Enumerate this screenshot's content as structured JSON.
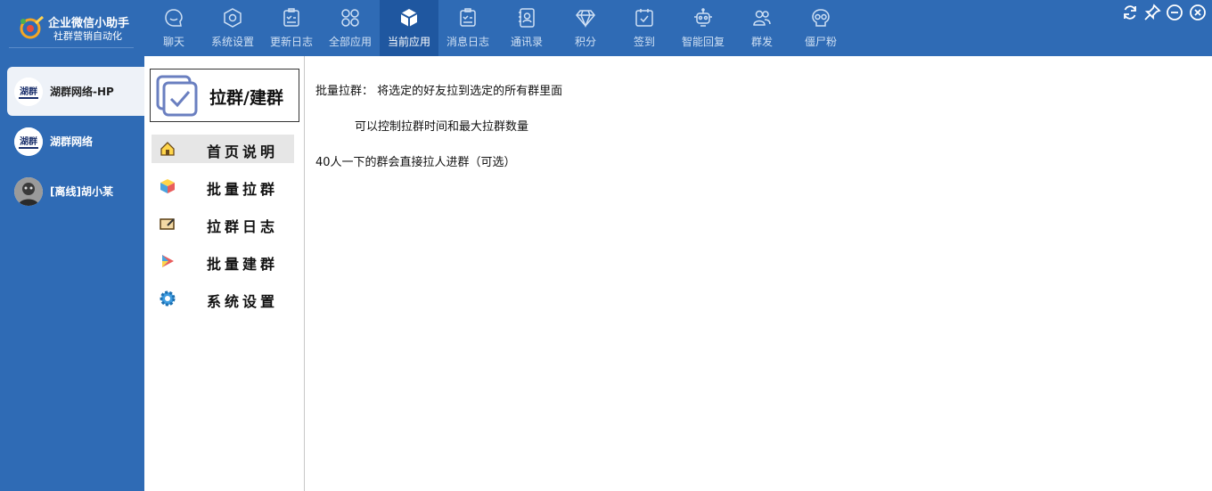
{
  "app": {
    "title": "企业微信小助手",
    "subtitle": "社群营销自动化"
  },
  "nav": [
    {
      "label": "聊天",
      "icon": "chat-icon",
      "active": false
    },
    {
      "label": "系统设置",
      "icon": "hexagon-settings-icon",
      "active": false
    },
    {
      "label": "更新日志",
      "icon": "checklist-icon",
      "active": false
    },
    {
      "label": "全部应用",
      "icon": "apps-grid-icon",
      "active": false
    },
    {
      "label": "当前应用",
      "icon": "cube-icon",
      "active": true
    },
    {
      "label": "消息日志",
      "icon": "checklist-icon",
      "active": false
    },
    {
      "label": "通讯录",
      "icon": "address-book-icon",
      "active": false
    },
    {
      "label": "积分",
      "icon": "diamond-icon",
      "active": false
    },
    {
      "label": "签到",
      "icon": "calendar-check-icon",
      "active": false
    },
    {
      "label": "智能回复",
      "icon": "robot-icon",
      "active": false
    },
    {
      "label": "群发",
      "icon": "users-icon",
      "active": false
    },
    {
      "label": "僵尸粉",
      "icon": "skull-icon",
      "active": false
    }
  ],
  "accounts": [
    {
      "name": "湖群网络-HP",
      "selected": true
    },
    {
      "name": "湖群网络",
      "selected": false
    },
    {
      "name": "[离线]胡小某",
      "selected": false
    }
  ],
  "avatar_text": "湖群",
  "menu": {
    "header": "拉群/建群",
    "items": [
      {
        "label": "首页说明",
        "icon": "home-icon",
        "active": true
      },
      {
        "label": "批量拉群",
        "icon": "cube-color-icon",
        "active": false
      },
      {
        "label": "拉群日志",
        "icon": "log-pen-icon",
        "active": false
      },
      {
        "label": "批量建群",
        "icon": "play-color-icon",
        "active": false
      },
      {
        "label": "系统设置",
        "icon": "gear-icon",
        "active": false
      }
    ]
  },
  "content": {
    "line1": "批量拉群：  将选定的好友拉到选定的所有群里面",
    "line2": "可以控制拉群时间和最大拉群数量",
    "line3": "40人一下的群会直接拉人进群（可选）"
  },
  "colors": {
    "topbar": "#2f6bb5",
    "nav_active": "#1f57a0",
    "sidebar": "#2f6bb5",
    "menu_active": "#e6e6e6"
  }
}
